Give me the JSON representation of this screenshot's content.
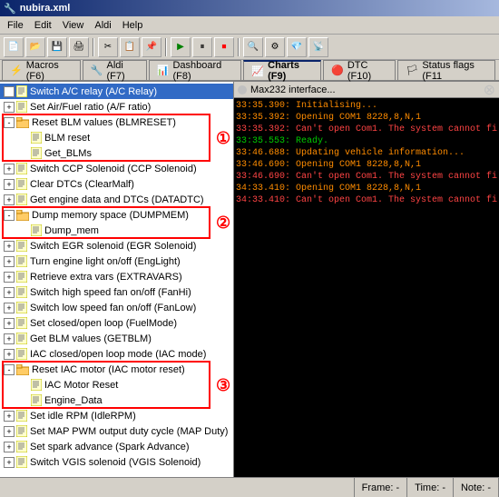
{
  "window": {
    "title": "nubira.xml"
  },
  "menu": {
    "items": [
      "File",
      "Edit",
      "View",
      "Aldi",
      "Help"
    ]
  },
  "tabs": [
    {
      "id": "macros",
      "label": "Macros (F6)",
      "icon": "⚡",
      "active": false
    },
    {
      "id": "aldi",
      "label": "Aldi (F7)",
      "icon": "🔧",
      "active": false
    },
    {
      "id": "dashboard",
      "label": "Dashboard (F8)",
      "icon": "📊",
      "active": false
    },
    {
      "id": "charts",
      "label": "Charts (F9)",
      "icon": "📈",
      "active": false
    },
    {
      "id": "dtc",
      "label": "DTC (F10)",
      "icon": "🔴",
      "active": false
    },
    {
      "id": "status",
      "label": "Status flags (F11",
      "icon": "🏳",
      "active": false
    }
  ],
  "tree": {
    "items": [
      {
        "id": 1,
        "level": 0,
        "expand": "+",
        "type": "script",
        "label": "Switch A/C relay (A/C Relay)",
        "selected": true,
        "group": null
      },
      {
        "id": 2,
        "level": 0,
        "expand": "+",
        "type": "script",
        "label": "Set Air/Fuel ratio (A/F ratio)",
        "selected": false,
        "group": null
      },
      {
        "id": 3,
        "level": 0,
        "expand": "-",
        "type": "folder",
        "label": "Reset BLM values (BLMRESET)",
        "selected": false,
        "group": 1,
        "groupStart": true
      },
      {
        "id": 4,
        "level": 1,
        "expand": null,
        "type": "script",
        "label": "BLM reset",
        "selected": false,
        "group": 1
      },
      {
        "id": 5,
        "level": 1,
        "expand": null,
        "type": "script",
        "label": "Get_BLMs",
        "selected": false,
        "group": 1,
        "groupEnd": true
      },
      {
        "id": 6,
        "level": 0,
        "expand": "+",
        "type": "script",
        "label": "Switch CCP Solenoid (CCP Solenoid)",
        "selected": false
      },
      {
        "id": 7,
        "level": 0,
        "expand": "+",
        "type": "script",
        "label": "Clear DTCs (ClearMalf)",
        "selected": false
      },
      {
        "id": 8,
        "level": 0,
        "expand": "+",
        "type": "script",
        "label": "Get engine data and DTCs (DATADTC)",
        "selected": false
      },
      {
        "id": 9,
        "level": 0,
        "expand": "-",
        "type": "folder",
        "label": "Dump memory space (DUMPMEM)",
        "selected": false,
        "group": 2,
        "groupStart": true
      },
      {
        "id": 10,
        "level": 1,
        "expand": null,
        "type": "script",
        "label": "Dump_mem",
        "selected": false,
        "group": 2,
        "groupEnd": true
      },
      {
        "id": 11,
        "level": 0,
        "expand": "+",
        "type": "script",
        "label": "Switch EGR solenoid (EGR Solenoid)",
        "selected": false
      },
      {
        "id": 12,
        "level": 0,
        "expand": "+",
        "type": "script",
        "label": "Turn engine light on/off (EngLight)",
        "selected": false
      },
      {
        "id": 13,
        "level": 0,
        "expand": "+",
        "type": "script",
        "label": "Retrieve extra vars (EXTRAVARS)",
        "selected": false
      },
      {
        "id": 14,
        "level": 0,
        "expand": "+",
        "type": "script",
        "label": "Switch high speed fan on/off (FanHi)",
        "selected": false
      },
      {
        "id": 15,
        "level": 0,
        "expand": "+",
        "type": "script",
        "label": "Switch low speed fan on/off (FanLow)",
        "selected": false
      },
      {
        "id": 16,
        "level": 0,
        "expand": "+",
        "type": "script",
        "label": "Set closed/open loop (FuelMode)",
        "selected": false
      },
      {
        "id": 17,
        "level": 0,
        "expand": "+",
        "type": "script",
        "label": "Get BLM values (GETBLM)",
        "selected": false
      },
      {
        "id": 18,
        "level": 0,
        "expand": "+",
        "type": "script",
        "label": "IAC closed/open loop mode (IAC mode)",
        "selected": false
      },
      {
        "id": 19,
        "level": 0,
        "expand": "-",
        "type": "folder",
        "label": "Reset IAC motor (IAC motor reset)",
        "selected": false,
        "group": 3,
        "groupStart": true
      },
      {
        "id": 20,
        "level": 1,
        "expand": null,
        "type": "script",
        "label": "IAC Motor Reset",
        "selected": false,
        "group": 3
      },
      {
        "id": 21,
        "level": 1,
        "expand": null,
        "type": "script",
        "label": "Engine_Data",
        "selected": false,
        "group": 3,
        "groupEnd": true
      },
      {
        "id": 22,
        "level": 0,
        "expand": "+",
        "type": "script",
        "label": "Set idle RPM (IdleRPM)",
        "selected": false
      },
      {
        "id": 23,
        "level": 0,
        "expand": "+",
        "type": "script",
        "label": "Set MAP PWM output duty cycle (MAP Duty)",
        "selected": false
      },
      {
        "id": 24,
        "level": 0,
        "expand": "+",
        "type": "script",
        "label": "Set spark advance (Spark Advance)",
        "selected": false
      },
      {
        "id": 25,
        "level": 0,
        "expand": "+",
        "type": "script",
        "label": "Switch VGIS solenoid (VGIS Solenoid)",
        "selected": false
      }
    ]
  },
  "log": {
    "header": "Max232 interface...",
    "lines": [
      {
        "type": "orange",
        "text": "33:35.390: Initialising..."
      },
      {
        "type": "orange",
        "text": "33:35.392: Opening COM1 8228,8,N,1"
      },
      {
        "type": "red",
        "text": "33:35.392: Can't open Com1. The system cannot fi"
      },
      {
        "type": "green",
        "text": "33:35.553: Ready."
      },
      {
        "type": "orange",
        "text": "33:46.688: Updating vehicle information..."
      },
      {
        "type": "orange",
        "text": "33:46.690: Opening COM1 8228,8,N,1"
      },
      {
        "type": "red",
        "text": "33:46.690: Can't open Com1. The system cannot fi"
      },
      {
        "type": "orange",
        "text": "34:33.410: Opening COM1 8228,8,N,1"
      },
      {
        "type": "red",
        "text": "34:33.410: Can't open Com1. The system cannot fi"
      }
    ]
  },
  "statusbar": {
    "frame_label": "Frame: -",
    "time_label": "Time: -",
    "note_label": "Note: -"
  },
  "groups": [
    {
      "number": "①",
      "label": "1"
    },
    {
      "number": "②",
      "label": "2"
    },
    {
      "number": "③",
      "label": "3"
    }
  ]
}
